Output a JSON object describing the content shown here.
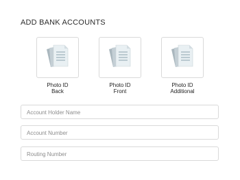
{
  "header": {
    "title": "ADD BANK ACCOUNTS"
  },
  "uploads": [
    {
      "line1": "Photo ID",
      "line2": "Back",
      "icon": "document-stack-icon"
    },
    {
      "line1": "Photo ID",
      "line2": "Front",
      "icon": "document-stack-icon"
    },
    {
      "line1": "Photo ID",
      "line2": "Additional",
      "icon": "document-stack-icon"
    }
  ],
  "form": {
    "account_holder": {
      "placeholder": "Account Holder Name",
      "value": ""
    },
    "account_number": {
      "placeholder": "Account Number",
      "value": ""
    },
    "routing_number": {
      "placeholder": "Routing Number",
      "value": ""
    }
  },
  "colors": {
    "border": "#d9d9d9",
    "doc_back": "#b3bfc6",
    "doc_front": "#e6eef2",
    "doc_lines": "#8aa2ad"
  }
}
